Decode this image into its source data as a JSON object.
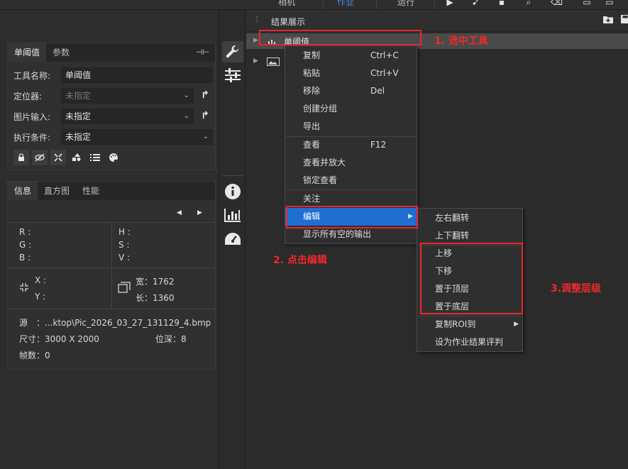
{
  "topbar": {
    "tabs": [
      "相机",
      "作业",
      "运行"
    ],
    "active_tab": "作业"
  },
  "tool_settings": {
    "tabs": [
      "单阈值",
      "参数"
    ],
    "name_label": "工具名称:",
    "name_value": "单阈值",
    "locator_label": "定位器:",
    "locator_value": "未指定",
    "image_input_label": "图片输入:",
    "image_input_value": "未指定",
    "exec_cond_label": "执行条件:",
    "exec_cond_value": "未指定"
  },
  "info_panel": {
    "tabs": [
      "信息",
      "直方图",
      "性能"
    ],
    "r_label": "R :",
    "g_label": "G :",
    "b_label": "B :",
    "h_label": "H :",
    "s_label": "S :",
    "v_label": "V :",
    "x_label": "X :",
    "y_label": "Y :",
    "width_text": "宽：1762",
    "height_text": "长：1360",
    "source_text": "源　：...ktop\\Pic_2026_03_27_131129_4.bmp",
    "size_text": "尺寸：3000 X 2000",
    "depth_text": "位深：8",
    "frames_text": "帧数：0"
  },
  "result_panel": {
    "title": "结果展示",
    "tree_item_1": "单阈值"
  },
  "context_menu": [
    {
      "label": "复制",
      "shortcut": "Ctrl+C"
    },
    {
      "label": "粘贴",
      "shortcut": "Ctrl+V"
    },
    {
      "label": "移除",
      "shortcut": "Del"
    },
    {
      "label": "创建分组",
      "shortcut": ""
    },
    {
      "label": "导出",
      "shortcut": ""
    },
    {
      "label": "查看",
      "shortcut": "F12"
    },
    {
      "label": "查看并放大",
      "shortcut": ""
    },
    {
      "label": "锁定查看",
      "shortcut": ""
    },
    {
      "label": "关注",
      "shortcut": ""
    },
    {
      "label": "编辑",
      "shortcut": ""
    },
    {
      "label": "显示所有空的输出",
      "shortcut": ""
    }
  ],
  "edit_submenu": [
    "左右翻转",
    "上下翻转",
    "上移",
    "下移",
    "置于顶层",
    "置于底层",
    "复制ROI到",
    "设为作业结果评判"
  ],
  "annotations": {
    "step1": "1. 选中工具",
    "step2": "2. 点击编辑",
    "step3": "3.调整层级"
  },
  "colors": {
    "accent_blue": "#1e6fd0",
    "annotation_red": "#e8262c",
    "panel_bg": "#2d2d2d"
  }
}
